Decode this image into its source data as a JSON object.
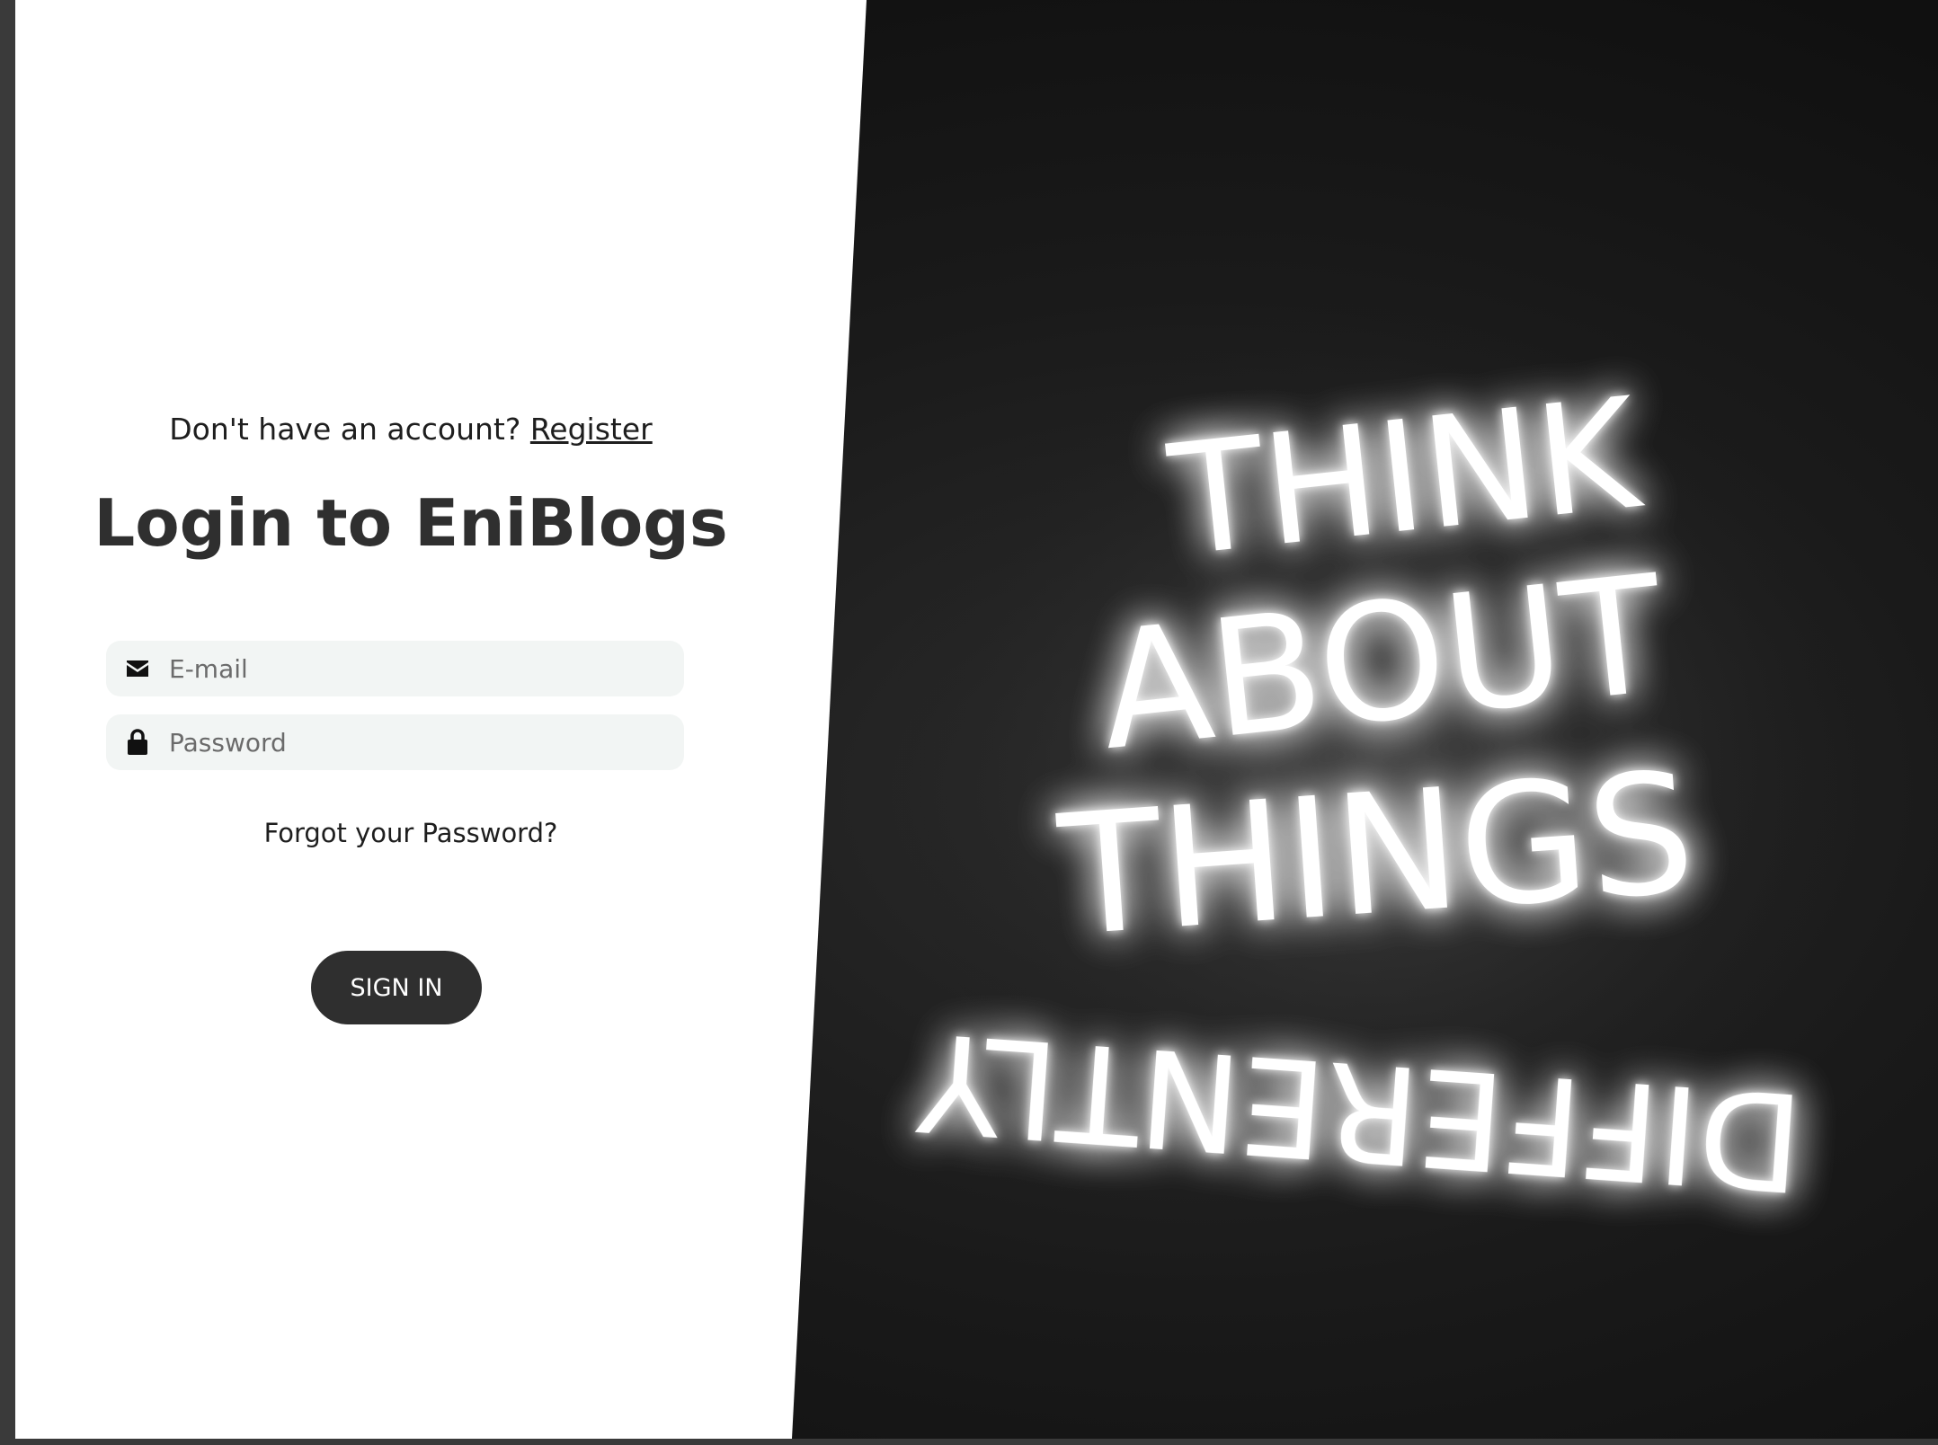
{
  "auth": {
    "register_prompt": "Don't have an account?",
    "register_link": "Register",
    "title": "Login to EniBlogs",
    "email_placeholder": "E-mail",
    "password_placeholder": "Password",
    "forgot_password": "Forgot your Password?",
    "sign_in": "SIGN IN"
  },
  "hero_image": {
    "lines": [
      "THINK",
      "ABOUT",
      "THINGS",
      "DIFFERENTLY"
    ]
  },
  "icons": {
    "email": "envelope-icon",
    "password": "lock-icon"
  },
  "colors": {
    "button_bg": "#2f2f2f",
    "field_bg": "#f2f5f4",
    "photo_bg": "#151515",
    "neon": "#ffffff"
  }
}
